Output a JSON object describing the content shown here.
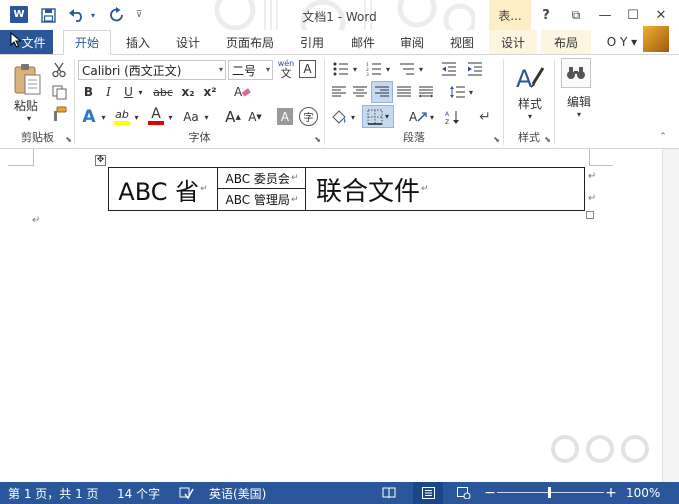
{
  "app": {
    "logo_letter": "W",
    "title": "文档1 - Word",
    "contextual_tab": "表...",
    "help": "?",
    "restore_ribbon": "⧉",
    "minimize": "—",
    "maximize": "☐",
    "close": "✕"
  },
  "qat": {
    "save_icon": "save-icon",
    "undo_icon": "undo-icon",
    "redo_icon": "redo-icon",
    "customize_icon": "customize-qat-icon"
  },
  "tabs": {
    "file": "文件",
    "home": "开始",
    "insert": "插入",
    "design": "设计",
    "page_layout": "页面布局",
    "references": "引用",
    "mailings": "邮件",
    "review": "审阅",
    "view": "视图",
    "table_design": "设计",
    "table_layout": "布局",
    "account": "O Y ▾"
  },
  "ribbon": {
    "clipboard": {
      "label": "剪贴板",
      "paste": "粘贴"
    },
    "font": {
      "label": "字体",
      "font_name": "Calibri (西文正文)",
      "font_size": "二号",
      "wen_top": "wén",
      "wen_bottom": "文",
      "a_box": "A",
      "bold": "B",
      "italic": "I",
      "underline": "U",
      "strike": "abc",
      "subscript": "x₂",
      "superscript": "x²",
      "grow": "A",
      "shrink": "A",
      "change_case": "Aa",
      "highlight": "ab",
      "font_color": "A",
      "shade": "A",
      "circle": "字"
    },
    "paragraph": {
      "label": "段落"
    },
    "styles": {
      "label": "样式",
      "button": "样式"
    },
    "editing": {
      "button": "编辑"
    }
  },
  "document": {
    "province_cell": "ABC 省",
    "org_1": "ABC 委员会",
    "org_2": "ABC 管理局",
    "joint_cell": "联合文件",
    "para_mark": "↵",
    "table_handle": "✥"
  },
  "statusbar": {
    "page": "第 1 页，共 1 页",
    "words": "14 个字",
    "language": "英语(美国)",
    "zoom_minus": "−",
    "zoom_plus": "+",
    "zoom": "100%",
    "zoom_level_percent": 100
  },
  "colors": {
    "accent": "#2b579a",
    "contextual": "#fdeec8",
    "highlight": "#ffff00",
    "font_color": "#e00000"
  }
}
